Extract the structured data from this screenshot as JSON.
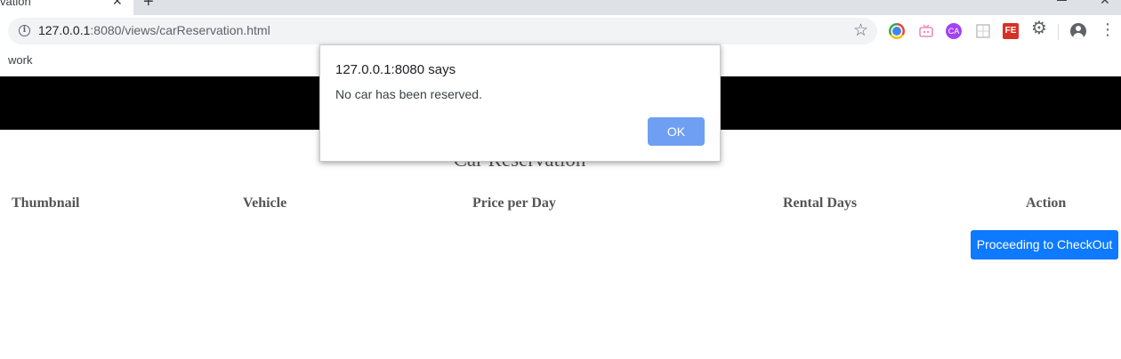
{
  "browser": {
    "tab_title": "vation",
    "tab_close": "✕",
    "new_tab": "+",
    "url_host": "127.0.0.1",
    "url_rest": ":8080/views/carReservation.html",
    "bookmark": "work",
    "extensions": [
      "chrome-icon",
      "tv-icon",
      "ca-icon",
      "grid-icon",
      "fe-icon",
      "gear-icon"
    ],
    "ext_ca_label": "CA",
    "ext_fe_label": "FE"
  },
  "page": {
    "title": "Car Reservation",
    "columns": [
      "Thumbnail",
      "Vehicle",
      "Price per Day",
      "Rental Days",
      "Action"
    ],
    "checkout_button": "Proceeding to CheckOut"
  },
  "alert": {
    "title": "127.0.0.1:8080 says",
    "message": "No car has been reserved.",
    "ok_label": "OK"
  },
  "colors": {
    "header_bar": "#000000",
    "checkout_button": "#0d7aff",
    "ok_button": "#6e9ff2"
  }
}
